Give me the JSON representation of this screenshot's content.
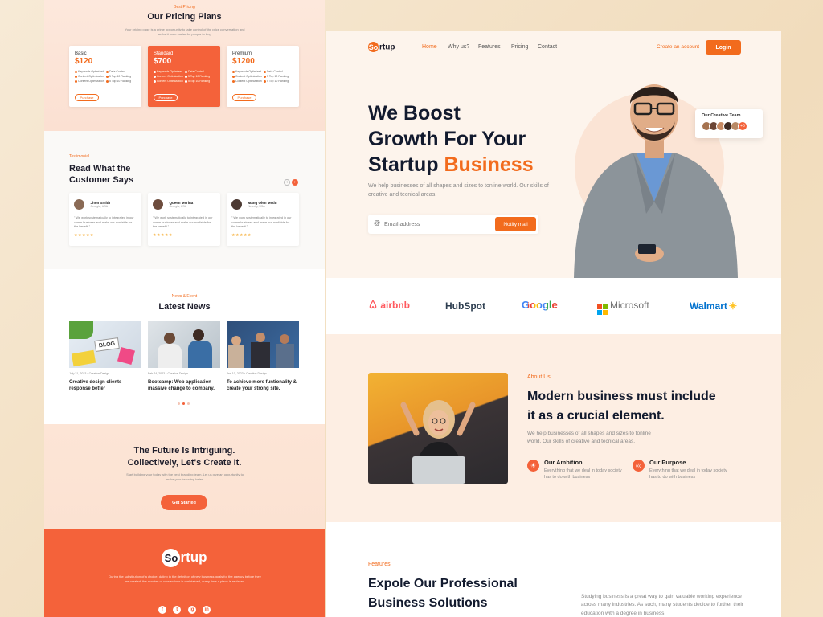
{
  "left": {
    "pricing": {
      "tag": "Best Pricing",
      "title": "Our Pricing Plans",
      "subtitle": "Your pricing page is a prime opportunity to take control of the price conversation and make it even easier for people to buy.",
      "plans": [
        {
          "name": "Basic",
          "price": "$120",
          "button": "Purchase",
          "features": [
            "Keywords Optimized",
            "Data Control",
            "Content Optimization",
            "5 Top 10 Ranking",
            "Content Optimization",
            "5 Top 10 Ranking"
          ]
        },
        {
          "name": "Standard",
          "price": "$700",
          "button": "Purchase",
          "features": [
            "Keywords Optimized",
            "Data Control",
            "Content Optimization",
            "5 Top 10 Ranking",
            "Content Optimization",
            "5 Top 10 Ranking"
          ]
        },
        {
          "name": "Premium",
          "price": "$1200",
          "button": "Purchase",
          "features": [
            "Keywords Optimized",
            "Data Control",
            "Content Optimization",
            "5 Top 10 Ranking",
            "Content Optimization",
            "5 Top 10 Ranking"
          ]
        }
      ]
    },
    "testimonials": {
      "tag": "Testimonial",
      "title_line1": "Read What the",
      "title_line2": "Customer Says",
      "items": [
        {
          "name": "Jhon Smith",
          "location": "Georgia, USA",
          "quote": "\" We work systematically to integrated in our comm business and make our available for the benefit \"",
          "stars": "★★★★★"
        },
        {
          "name": "Queen Merina",
          "location": "Georgia, USA",
          "quote": "\" We work systematically to integrated in our comm business and make our available for the benefit \"",
          "stars": "★★★★★"
        },
        {
          "name": "Mang Olen Medu",
          "location": "Newcity, USA",
          "quote": "\" We work systematically to integrated in our comm business and make our available for the benefit \"",
          "stars": "★★★★★"
        }
      ]
    },
    "news": {
      "tag": "News & Event",
      "title": "Latest News",
      "items": [
        {
          "date": "July 31, 2023",
          "category": "Creative Design",
          "title": "Creative design clients response better",
          "image_label": "BLOG"
        },
        {
          "date": "Feb 24, 2023",
          "category": "Creative Design",
          "title": "Bootcamp: Web application massive change to company."
        },
        {
          "date": "Jan 10, 2023",
          "category": "Creative Design",
          "title": "To achieve more funtionality & create your strong site."
        }
      ]
    },
    "cta": {
      "title_line1": "The Future Is Intriguing.",
      "title_line2": "Collectively, Let's Create It.",
      "text": "Start building your today with the best branding team. Let us give an oppurtunity to make your branding beter.",
      "button": "Get Started"
    },
    "footer": {
      "logo_o": "So",
      "logo_rest": "rtup",
      "text": "During the substitution of a choice, dating in the definition of new business goals for the agency before they are created, the number of connections is maintained, every time a piece is replaced.",
      "social": [
        "f",
        "t",
        "ig",
        "in"
      ]
    }
  },
  "right": {
    "nav": {
      "logo_o": "So",
      "logo_rest": "rtup",
      "links": [
        "Home",
        "Why us?",
        "Features",
        "Pricing",
        "Contact"
      ],
      "create_account": "Create an account",
      "login": "Login"
    },
    "hero": {
      "line1": "We Boost",
      "line2": "Growth For Your",
      "line3a": "Startup ",
      "line3b": "Business",
      "subtitle": "We help businesses of all shapes and sizes to tonline world. Our skills of creative and tecnical areas.",
      "email_placeholder": "Email address",
      "notify_button": "Notify mail",
      "team_label": "Our Creative Team",
      "team_more": "+5"
    },
    "brands": [
      "airbnb",
      "HubSpot",
      "Google",
      "Microsoft",
      "Walmart"
    ],
    "about": {
      "tag": "About Us",
      "title_line1": "Modern business must include",
      "title_line2": "it as a crucial element.",
      "text": "We help businesses of all shapes and sizes to tonline world. Our skills of creative and tecnical areas.",
      "items": [
        {
          "title": "Our Ambition",
          "text": "Everything that we deal in today society has to do with business"
        },
        {
          "title": "Our Purpose",
          "text": "Everything that we deal in today society has to do with business"
        }
      ]
    },
    "features": {
      "tag": "Features",
      "title_line1": "Expole Our Professional",
      "title_line2": "Business Solutions",
      "text": "Studying business is a great way to gain valuable working experience across many industries. As such, many students decide to further their education with a degree in business."
    }
  }
}
